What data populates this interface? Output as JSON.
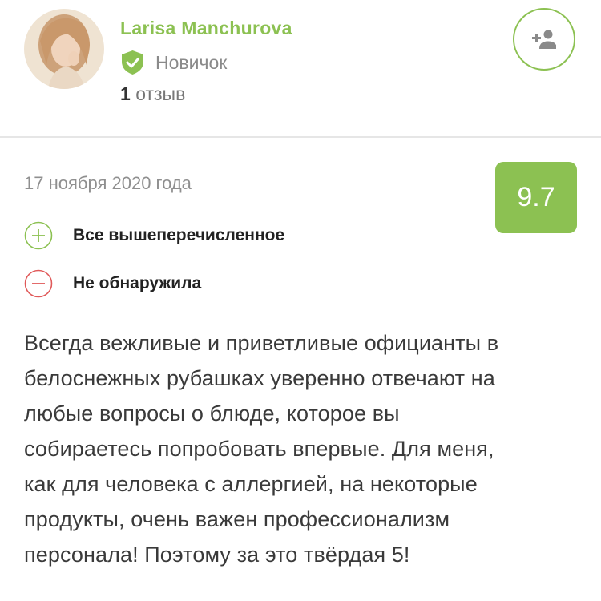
{
  "user": {
    "name": "Larisa Manchurova",
    "status": "Новичок",
    "reviews_count": "1",
    "reviews_label": "отзыв"
  },
  "review": {
    "date": "17 ноября 2020 года",
    "rating": "9.7",
    "pros": "Все вышеперечисленное",
    "cons": "Не обнаружила",
    "text_lines": [
      "Всегда вежливые и приветливые официанты в",
      "белоснежных рубашках уверенно отвечают на",
      "любые вопросы о блюде, которое вы",
      "собираетесь попробовать впервые. Для меня,",
      "как для человека с аллергией, на некоторые",
      "продукты, очень важен профессионализм",
      "персонала! Поэтому за это твёрдая 5!"
    ]
  },
  "icons": {
    "status": "shield-check-icon",
    "follow": "person-add-icon",
    "pros": "plus-circle-icon",
    "cons": "minus-circle-icon"
  },
  "colors": {
    "accent": "#8cc152",
    "negative": "#e05a5a",
    "divider": "#e6e6e6"
  }
}
